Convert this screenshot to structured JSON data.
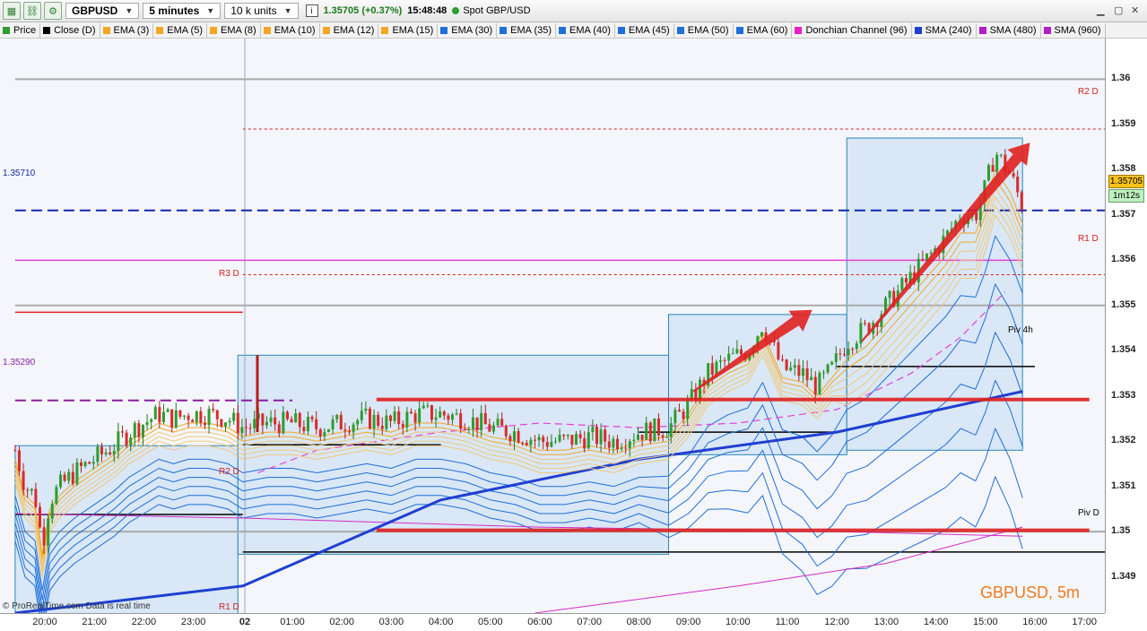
{
  "toolbar": {
    "instrument": "GBPUSD",
    "timeframe": "5 minutes",
    "units": "10 k units",
    "price_change": "1.35705 (+0.37%)",
    "clock": "15:48:48",
    "source": "Spot GBP/USD"
  },
  "legend": [
    {
      "label": "Price",
      "color": "#2e9d2e"
    },
    {
      "label": "Close (D)",
      "color": "#000000"
    },
    {
      "label": "EMA (3)",
      "color": "#f5a623"
    },
    {
      "label": "EMA (5)",
      "color": "#f5a623"
    },
    {
      "label": "EMA (8)",
      "color": "#f5a623"
    },
    {
      "label": "EMA (10)",
      "color": "#f5a623"
    },
    {
      "label": "EMA (12)",
      "color": "#f5a623"
    },
    {
      "label": "EMA (15)",
      "color": "#f5a623"
    },
    {
      "label": "EMA (30)",
      "color": "#1e6fd9"
    },
    {
      "label": "EMA (35)",
      "color": "#1e6fd9"
    },
    {
      "label": "EMA (40)",
      "color": "#1e6fd9"
    },
    {
      "label": "EMA (45)",
      "color": "#1e6fd9"
    },
    {
      "label": "EMA (50)",
      "color": "#1e6fd9"
    },
    {
      "label": "EMA (60)",
      "color": "#1e6fd9"
    },
    {
      "label": "Donchian Channel (96)",
      "color": "#e91ec8"
    },
    {
      "label": "SMA (240)",
      "color": "#1f3fd1"
    },
    {
      "label": "SMA (480)",
      "color": "#b21ec8"
    },
    {
      "label": "SMA (960)",
      "color": "#b21ec8"
    }
  ],
  "labels": {
    "level_1_3571": "1.35710",
    "level_1_3529": "1.35290",
    "r3d": "R3 D",
    "r2d_left": "R2 D",
    "r1d_left": "R1 D",
    "r2d_right": "R2 D",
    "r1d_right": "R1 D",
    "piv_4h": "Piv 4h",
    "piv_d": "Piv D",
    "current_price": "1.35705",
    "countdown": "1m12s",
    "watermark": "GBPUSD, 5m",
    "credit": "© ProRealTime.com  Data is real time"
  },
  "colors": {
    "up_candle": "#2e9d2e",
    "down_candle": "#d92b2b",
    "ema_fast": "#f5a623",
    "ema_slow": "#1e6fd9",
    "sma240": "#1f3fd1",
    "sma480": "#d42bc9",
    "donchian_fill": "#dbe8f5",
    "support_line": "#e02020",
    "arrow": "#e02020",
    "magenta_level": "#e83fd3"
  },
  "chart_data": {
    "type": "candlestick",
    "title": "GBPUSD, 5m",
    "ylim": [
      1.3482,
      1.3609
    ],
    "y_ticks": [
      1.349,
      1.35,
      1.351,
      1.352,
      1.353,
      1.354,
      1.355,
      1.356,
      1.357,
      1.358,
      1.359,
      1.36
    ],
    "y_tick_labels": [
      "1.349",
      "1.35",
      "1.351",
      "1.352",
      "1.353",
      "1.354",
      "1.355",
      "1.356",
      "1.357",
      "1.358",
      "1.359",
      "1.36"
    ],
    "x_ticks": [
      "20:00",
      "21:00",
      "22:00",
      "23:00",
      "02",
      "01:00",
      "02:00",
      "03:00",
      "04:00",
      "05:00",
      "06:00",
      "07:00",
      "08:00",
      "09:00",
      "10:00",
      "11:00",
      "12:00",
      "13:00",
      "14:00",
      "15:00",
      "16:00",
      "17:00"
    ],
    "close_path": [
      [
        19.4,
        1.3518
      ],
      [
        19.6,
        1.351
      ],
      [
        19.8,
        1.3508
      ],
      [
        19.95,
        1.3497
      ],
      [
        20.1,
        1.3507
      ],
      [
        20.3,
        1.351
      ],
      [
        20.6,
        1.3513
      ],
      [
        21.0,
        1.3516
      ],
      [
        21.4,
        1.3519
      ],
      [
        21.7,
        1.3522
      ],
      [
        22.0,
        1.3524
      ],
      [
        22.3,
        1.3526
      ],
      [
        22.6,
        1.3525
      ],
      [
        22.9,
        1.3526
      ],
      [
        23.3,
        1.3526
      ],
      [
        23.7,
        1.3525
      ],
      [
        24.0,
        1.3523
      ],
      [
        24.5,
        1.3524
      ],
      [
        25.0,
        1.3524
      ],
      [
        25.5,
        1.3523
      ],
      [
        26.0,
        1.3524
      ],
      [
        26.5,
        1.3525
      ],
      [
        27.0,
        1.3524
      ],
      [
        27.5,
        1.3526
      ],
      [
        28.0,
        1.3526
      ],
      [
        28.5,
        1.3525
      ],
      [
        29.0,
        1.3523
      ],
      [
        29.5,
        1.3522
      ],
      [
        30.0,
        1.352
      ],
      [
        30.5,
        1.352
      ],
      [
        31.0,
        1.3521
      ],
      [
        31.5,
        1.352
      ],
      [
        32.0,
        1.3522
      ],
      [
        32.6,
        1.3523
      ],
      [
        33.0,
        1.3528
      ],
      [
        33.4,
        1.3535
      ],
      [
        33.8,
        1.3538
      ],
      [
        34.2,
        1.354
      ],
      [
        34.5,
        1.3546
      ],
      [
        34.9,
        1.3536
      ],
      [
        35.3,
        1.3535
      ],
      [
        35.6,
        1.3532
      ],
      [
        35.9,
        1.3536
      ],
      [
        36.2,
        1.3542
      ],
      [
        36.6,
        1.3545
      ],
      [
        37.0,
        1.355
      ],
      [
        37.4,
        1.3555
      ],
      [
        37.8,
        1.356
      ],
      [
        38.2,
        1.3565
      ],
      [
        38.5,
        1.357
      ],
      [
        38.8,
        1.357
      ],
      [
        39.0,
        1.3576
      ],
      [
        39.2,
        1.3584
      ],
      [
        39.5,
        1.3579
      ],
      [
        39.75,
        1.3572
      ]
    ],
    "ema_offsets": [
      0.0002,
      0.0003,
      0.0004,
      0.0005,
      0.0006,
      0.0007
    ],
    "ema_slow_offsets": [
      0.001,
      0.0012,
      0.0014,
      0.0016,
      0.0018,
      0.002
    ],
    "sma240": [
      [
        19.4,
        1.3482
      ],
      [
        24.0,
        1.3488
      ],
      [
        28.0,
        1.3507
      ],
      [
        32.0,
        1.3516
      ],
      [
        36.0,
        1.3522
      ],
      [
        39.75,
        1.3531
      ]
    ],
    "sma480": [
      [
        29.9,
        1.3482
      ],
      [
        34.0,
        1.3488
      ],
      [
        37.0,
        1.3493
      ],
      [
        39.75,
        1.3501
      ]
    ],
    "sma480_upper": [
      [
        19.4,
        1.3504
      ],
      [
        24.0,
        1.3503
      ],
      [
        30.0,
        1.3501
      ],
      [
        36.0,
        1.35
      ],
      [
        39.75,
        1.3499
      ]
    ],
    "donchian_segments": [
      {
        "x0": 19.4,
        "x1": 23.9,
        "lo": 1.3472,
        "hi": 1.3519
      },
      {
        "x0": 23.9,
        "x1": 32.6,
        "lo": 1.3495,
        "hi": 1.3539
      },
      {
        "x0": 32.6,
        "x1": 36.2,
        "lo": 1.3517,
        "hi": 1.3548
      },
      {
        "x0": 36.2,
        "x1": 39.75,
        "lo": 1.3518,
        "hi": 1.3587
      }
    ],
    "levels": [
      {
        "name": "level_1_3571",
        "y": 1.3571,
        "x0": 19.4,
        "x1": 41.5,
        "style": "dash",
        "color": "#1228a8"
      },
      {
        "name": "level_1_3529",
        "y": 1.3529,
        "x0": 19.4,
        "x1": 25.0,
        "style": "dash",
        "color": "#8a1da0"
      },
      {
        "name": "magenta_1_356",
        "y": 1.356,
        "x0": 19.4,
        "x1": 39.75,
        "style": "solid",
        "color": "#e83fd3"
      },
      {
        "name": "r3d",
        "y": 1.35485,
        "x0": 19.4,
        "x1": 24.0,
        "style": "solid",
        "color": "#e02020"
      },
      {
        "name": "grey_1_355",
        "y": 1.355,
        "x0": 19.4,
        "x1": 41.5,
        "style": "solid",
        "color": "#aaaaaa"
      },
      {
        "name": "grey_1_36",
        "y": 1.36,
        "x0": 19.4,
        "x1": 41.5,
        "style": "solid",
        "color": "#aaaaaa"
      },
      {
        "name": "grey_1_35",
        "y": 1.35,
        "x0": 19.4,
        "x1": 41.5,
        "style": "solid",
        "color": "#aaaaaa"
      },
      {
        "name": "r2d_right",
        "y": 1.3589,
        "x0": 24.0,
        "x1": 41.5,
        "style": "dotted",
        "color": "#d42020"
      },
      {
        "name": "r1d_right",
        "y": 1.35568,
        "x0": 24.0,
        "x1": 41.5,
        "style": "dotted",
        "color": "#d42020"
      },
      {
        "name": "piv_d",
        "y": 1.34955,
        "x0": 24.0,
        "x1": 41.5,
        "style": "solid",
        "color": "#000000"
      },
      {
        "name": "piv_4h",
        "y": 1.35365,
        "x0": 36.0,
        "x1": 40.0,
        "style": "solid",
        "color": "#000000"
      },
      {
        "name": "black_left",
        "y": 1.35038,
        "x0": 19.4,
        "x1": 24.0,
        "style": "solid",
        "color": "#000000"
      },
      {
        "name": "black_mid",
        "y": 1.35192,
        "x0": 24.0,
        "x1": 28.0,
        "style": "solid",
        "color": "#000000"
      },
      {
        "name": "black_mid2",
        "y": 1.3522,
        "x0": 32.0,
        "x1": 36.0,
        "style": "solid",
        "color": "#000000"
      }
    ],
    "support_lines": [
      {
        "y": 1.35292,
        "x0": 26.7,
        "x1": 41.1
      },
      {
        "y": 1.35003,
        "x0": 26.7,
        "x1": 41.1
      }
    ],
    "arrows": [
      {
        "from": [
          33.1,
          1.3531
        ],
        "to": [
          35.5,
          1.3549
        ]
      },
      {
        "from": [
          36.5,
          1.3542
        ],
        "to": [
          39.9,
          1.3586
        ]
      }
    ]
  }
}
